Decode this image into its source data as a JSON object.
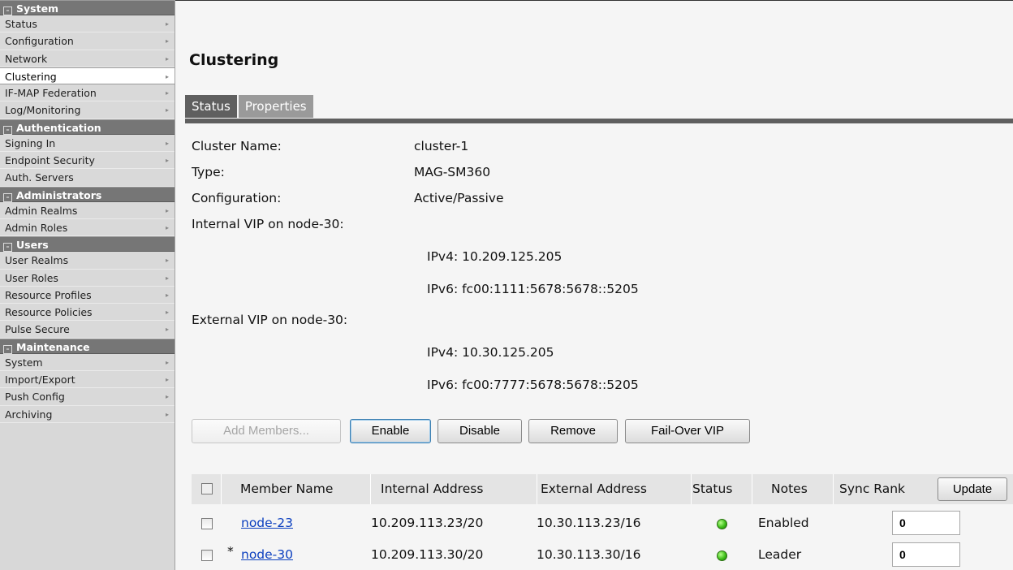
{
  "sidebar": {
    "sections": [
      {
        "title": "System",
        "items": [
          "Status",
          "Configuration",
          "Network",
          "Clustering",
          "IF-MAP Federation",
          "Log/Monitoring"
        ]
      },
      {
        "title": "Authentication",
        "items": [
          "Signing In",
          "Endpoint Security",
          "Auth. Servers"
        ]
      },
      {
        "title": "Administrators",
        "items": [
          "Admin Realms",
          "Admin Roles"
        ]
      },
      {
        "title": "Users",
        "items": [
          "User Realms",
          "User Roles",
          "Resource Profiles",
          "Resource Policies",
          "Pulse Secure"
        ]
      },
      {
        "title": "Maintenance",
        "items": [
          "System",
          "Import/Export",
          "Push Config",
          "Archiving"
        ]
      }
    ],
    "selected": "Clustering"
  },
  "page": {
    "title": "Clustering",
    "tabs": [
      "Status",
      "Properties"
    ],
    "active_tab": "Status"
  },
  "info": {
    "cluster_name_label": "Cluster Name:",
    "cluster_name": "cluster-1",
    "type_label": "Type:",
    "type": "MAG-SM360",
    "configuration_label": "Configuration:",
    "configuration": "Active/Passive",
    "internal_vip_label": "Internal VIP on node-30:",
    "internal_ipv4": "IPv4: 10.209.125.205",
    "internal_ipv6": "IPv6: fc00:1111:5678:5678::5205",
    "external_vip_label": "External VIP on node-30:",
    "external_ipv4": "IPv4: 10.30.125.205",
    "external_ipv6": "IPv6: fc00:7777:5678:5678::5205"
  },
  "buttons": {
    "add_members": "Add Members...",
    "enable": "Enable",
    "disable": "Disable",
    "remove": "Remove",
    "failover_vip": "Fail-Over VIP",
    "update": "Update"
  },
  "table": {
    "headers": {
      "member_name": "Member Name",
      "internal_address": "Internal Address",
      "external_address": "External Address",
      "status": "Status",
      "notes": "Notes",
      "sync_rank": "Sync Rank"
    },
    "rows": [
      {
        "marker": "",
        "name": "node-23",
        "internal": "10.209.113.23/20",
        "external": "10.30.113.23/16",
        "status_color": "#3fbf1a",
        "notes": "Enabled",
        "rank": "0"
      },
      {
        "marker": "*",
        "name": "node-30",
        "internal": "10.209.113.30/20",
        "external": "10.30.113.30/16",
        "status_color": "#3fbf1a",
        "notes": "Leader",
        "rank": "0"
      }
    ]
  }
}
